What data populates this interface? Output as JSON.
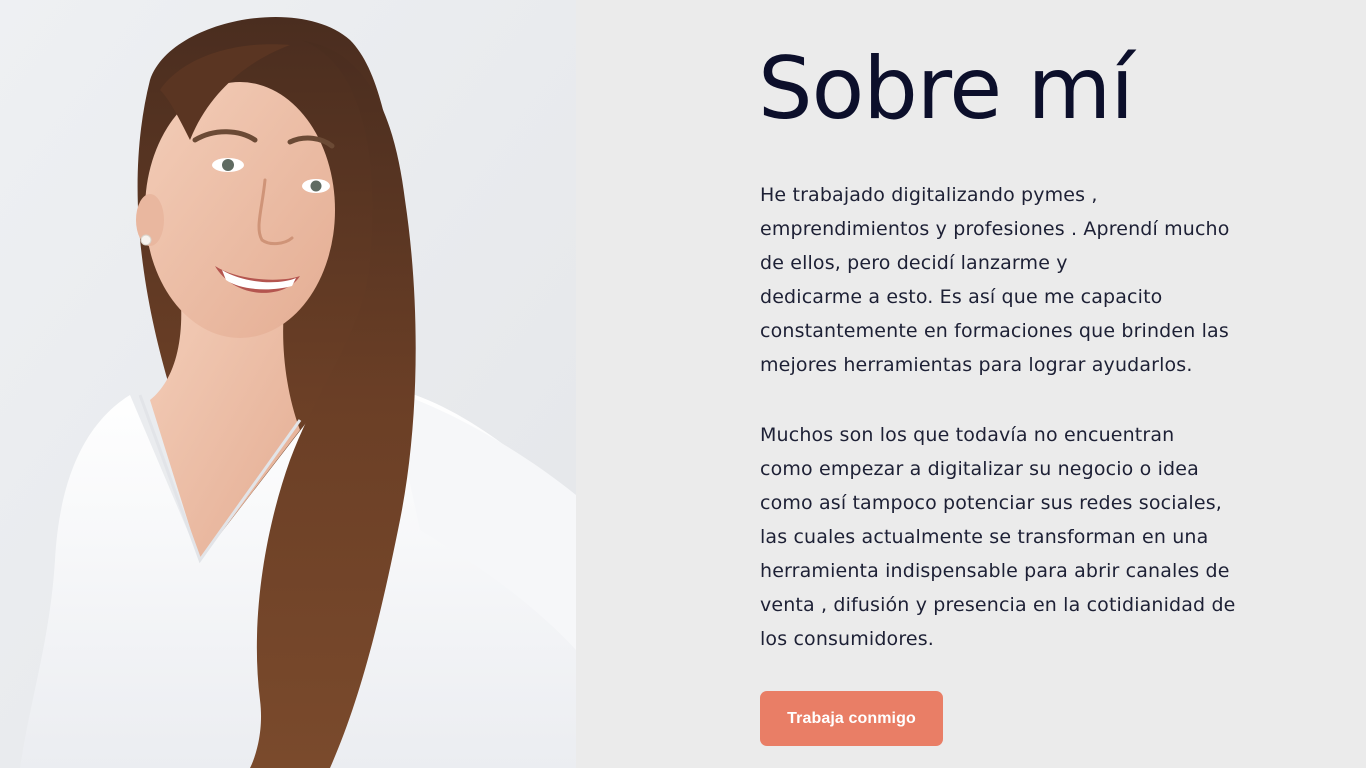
{
  "about": {
    "title": "Sobre mí",
    "paragraph1_lines": [
      "He trabajado digitalizando pymes ,",
      "emprendimientos y profesiones . Aprendí mucho",
      "de ellos, pero decidí lanzarme y",
      "dedicarme a esto. Es así que me capacito",
      "constantemente en formaciones que brinden las",
      "mejores herramientas para lograr ayudarlos."
    ],
    "paragraph2_lines": [
      "Muchos son  los que todavía no encuentran",
      "como empezar a digitalizar su negocio o idea",
      "como así tampoco potenciar sus redes sociales,",
      "las cuales actualmente se transforman en una",
      "herramienta indispensable para abrir canales de",
      "venta , difusión y presencia en la cotidianidad de",
      "los consumidores."
    ],
    "cta_label": "Trabaja conmigo"
  },
  "colors": {
    "background": "#ebebeb",
    "title": "#0c0f2b",
    "body_text": "#1d2035",
    "cta_background": "#e97e66",
    "cta_text": "#ffffff"
  }
}
